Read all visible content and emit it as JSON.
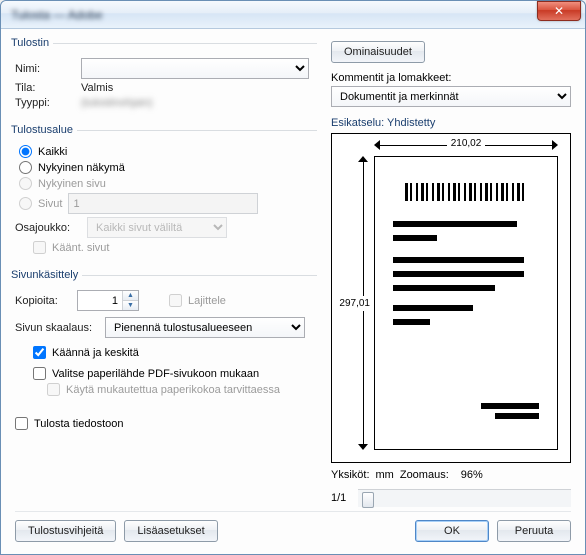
{
  "window": {
    "title": "Tulosta — Adobe"
  },
  "printer": {
    "legend": "Tulostin",
    "name_label": "Nimi:",
    "name_value": "",
    "status_label": "Tila:",
    "status_value": "Valmis",
    "type_label": "Tyyppi:",
    "type_value": "(tulostinohjain)",
    "properties_btn": "Ominaisuudet",
    "comments_label": "Kommentit ja lomakkeet:",
    "comments_value": "Dokumentit ja merkinnät"
  },
  "range": {
    "legend": "Tulostusalue",
    "all": "Kaikki",
    "current_view": "Nykyinen näkymä",
    "current_page": "Nykyinen sivu",
    "pages": "Sivut",
    "pages_value": "1",
    "subset_label": "Osajoukko:",
    "subset_value": "Kaikki sivut väliltä",
    "reverse": "Käänt. sivut"
  },
  "handling": {
    "legend": "Sivunkäsittely",
    "copies_label": "Kopioita:",
    "copies_value": "1",
    "collate": "Lajittele",
    "scale_label": "Sivun skaalaus:",
    "scale_value": "Pienennä tulostusalueeseen",
    "rotate_center": "Käännä ja keskitä",
    "choose_paper": "Valitse paperilähde PDF-sivukoon mukaan",
    "custom_paper": "Käytä mukautettua paperikokoa tarvittaessa"
  },
  "to_file": "Tulosta tiedostoon",
  "preview": {
    "label": "Esikatselu: Yhdistetty",
    "width": "210,02",
    "height": "297,01",
    "units_prefix": "Yksiköt:",
    "units": "mm",
    "zoom_prefix": "Zoomaus:",
    "zoom": "96%",
    "page_of": "1/1"
  },
  "footer": {
    "tips": "Tulostusvihjeitä",
    "advanced": "Lisäasetukset",
    "ok": "OK",
    "cancel": "Peruuta"
  }
}
